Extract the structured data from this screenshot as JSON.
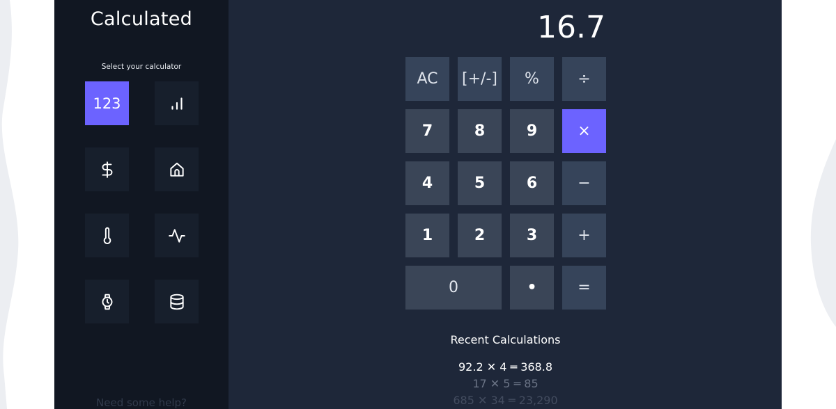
{
  "sidebar": {
    "title": "Calculated",
    "select_label": "Select your calculator",
    "calculators": [
      {
        "label": "123",
        "icon": "numbers-icon",
        "active": true
      },
      {
        "label": "",
        "icon": "bar-chart-icon",
        "active": false
      },
      {
        "label": "",
        "icon": "dollar-icon",
        "active": false
      },
      {
        "label": "",
        "icon": "home-icon",
        "active": false
      },
      {
        "label": "",
        "icon": "thermometer-icon",
        "active": false
      },
      {
        "label": "",
        "icon": "activity-icon",
        "active": false
      },
      {
        "label": "",
        "icon": "watch-icon",
        "active": false
      },
      {
        "label": "",
        "icon": "database-icon",
        "active": false
      }
    ],
    "help_text": "Need some help?"
  },
  "display": {
    "value": "16.7"
  },
  "keypad": {
    "clear": "AC",
    "sign": "[+/-]",
    "percent": "%",
    "divide": "÷",
    "seven": "7",
    "eight": "8",
    "nine": "9",
    "multiply": "×",
    "four": "4",
    "five": "5",
    "six": "6",
    "subtract": "−",
    "one": "1",
    "two": "2",
    "three": "3",
    "add": "+",
    "zero": "0",
    "decimal": "•",
    "equals": "="
  },
  "recent": {
    "title": "Recent Calculations",
    "items": [
      "92.2 ✕ 4 ═ 368.8",
      "17 ✕ 5 ═ 85",
      "685 ✕ 34 ═ 23,290"
    ]
  },
  "colors": {
    "accent": "#6c63ff",
    "sidebar_bg": "#111722",
    "main_bg": "#1e2739",
    "key_bg": "#3a4557"
  }
}
